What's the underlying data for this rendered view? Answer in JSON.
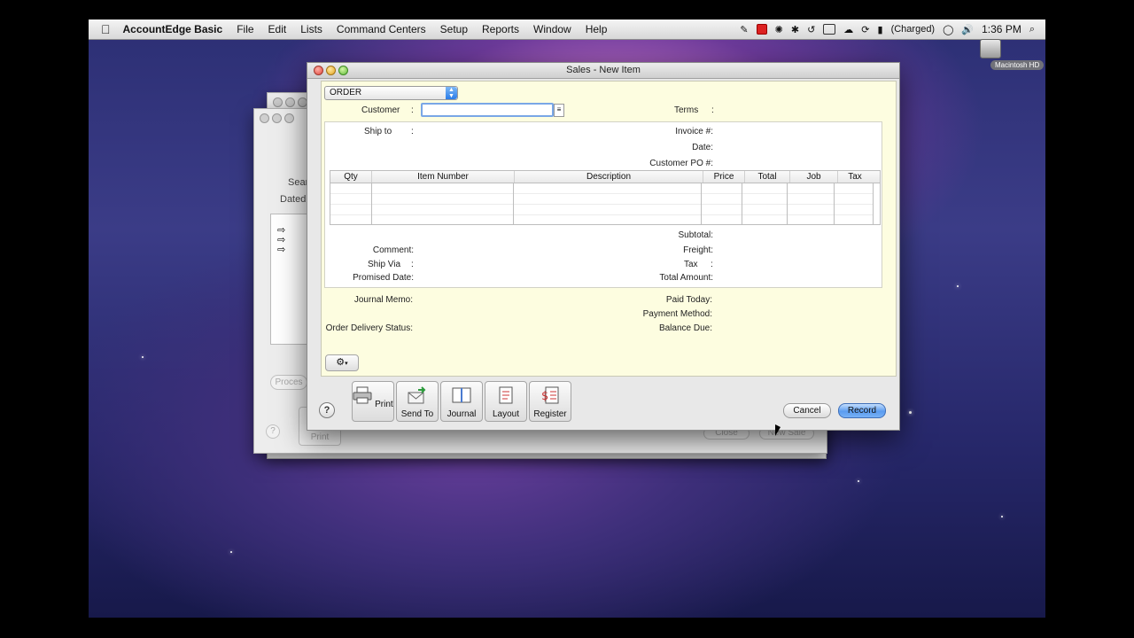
{
  "menubar": {
    "app_name": "AccountEdge Basic",
    "items": [
      "File",
      "Edit",
      "Lists",
      "Command Centers",
      "Setup",
      "Reports",
      "Window",
      "Help"
    ],
    "battery_status": "(Charged)",
    "clock": "1:36 PM"
  },
  "desktop": {
    "drive_label": "Macintosh HD"
  },
  "background_window": {
    "search_label": "Searc",
    "dated_label": "Dated",
    "process_button": "Proces",
    "print_button": "Print",
    "close_button": "Close",
    "new_sale_button": "New Sale"
  },
  "window": {
    "title": "Sales - New Item"
  },
  "form": {
    "layout_select": "ORDER",
    "customer_label": "Customer",
    "customer_value": "",
    "terms_label": "Terms",
    "ship_to_label": "Ship to",
    "invoice_label": "Invoice #:",
    "date_label": "Date:",
    "customer_po_label": "Customer PO #:",
    "columns": [
      "Qty",
      "Item Number",
      "Description",
      "Price",
      "Total",
      "Job",
      "Tax"
    ],
    "subtotal_label": "Subtotal:",
    "comment_label": "Comment:",
    "freight_label": "Freight:",
    "ship_via_label": "Ship Via",
    "tax_label": "Tax",
    "promised_date_label": "Promised Date:",
    "total_amount_label": "Total Amount:",
    "journal_memo_label": "Journal Memo:",
    "paid_today_label": "Paid Today:",
    "payment_method_label": "Payment Method:",
    "order_delivery_status_label": "Order Delivery Status:",
    "balance_due_label": "Balance Due:"
  },
  "toolbar": {
    "print": "Print",
    "send_to": "Send To",
    "journal": "Journal",
    "layout": "Layout",
    "register": "Register",
    "cancel": "Cancel",
    "record": "Record"
  }
}
